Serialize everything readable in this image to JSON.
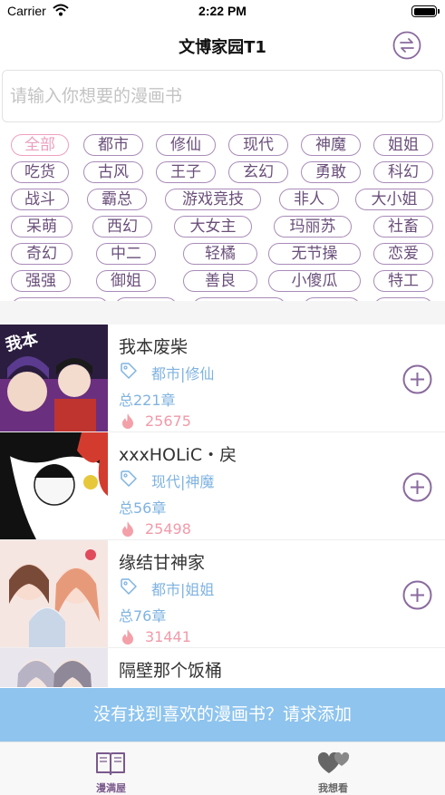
{
  "status": {
    "carrier": "Carrier",
    "time": "2:22 PM"
  },
  "nav": {
    "title": "文博家园T1",
    "swap_icon": "swap-arrows-icon"
  },
  "search": {
    "placeholder": "请输入你想要的漫画书",
    "value": ""
  },
  "tags": {
    "active": "全部",
    "rows": [
      [
        "全部",
        "都市",
        "修仙",
        "现代",
        "神魔",
        "姐姐"
      ],
      [
        "吃货",
        "古风",
        "王子",
        "玄幻",
        "勇敢",
        "科幻"
      ],
      [
        "战斗",
        "霸总",
        "游戏竞技",
        "非人",
        "大小姐"
      ],
      [
        "呆萌",
        "西幻",
        "大女主",
        "玛丽苏",
        "社畜"
      ],
      [
        "奇幻",
        "中二",
        "轻橘",
        "无节操",
        "恋爱"
      ],
      [
        "强强",
        "御姐",
        "善良",
        "小傻瓜",
        "特工"
      ],
      [
        "",
        "",
        "",
        "",
        ""
      ]
    ]
  },
  "manga": [
    {
      "title": "我本废柴",
      "genre": "都市|修仙",
      "chapters": "总221章",
      "hot": "25675"
    },
    {
      "title": "xxxHOLiC・戻",
      "genre": "现代|神魔",
      "chapters": "总56章",
      "hot": "25498"
    },
    {
      "title": "缘结甘神家",
      "genre": "都市|姐姐",
      "chapters": "总76章",
      "hot": "31441"
    },
    {
      "title": "隔壁那个饭桶",
      "genre": "",
      "chapters": "",
      "hot": ""
    }
  ],
  "request_bar": {
    "label": "没有找到喜欢的漫画书？请求添加"
  },
  "tabbar": {
    "items": [
      {
        "label": "漫满屋",
        "icon": "book-icon",
        "active": true
      },
      {
        "label": "我想看",
        "icon": "hearts-icon",
        "active": false
      }
    ]
  },
  "colors": {
    "accent": "#a98bb9",
    "tag_active": "#ec9fbe",
    "info_blue": "#7fb3e0",
    "hot_pink": "#f19aa9",
    "request_bar": "#8ec4ee"
  }
}
